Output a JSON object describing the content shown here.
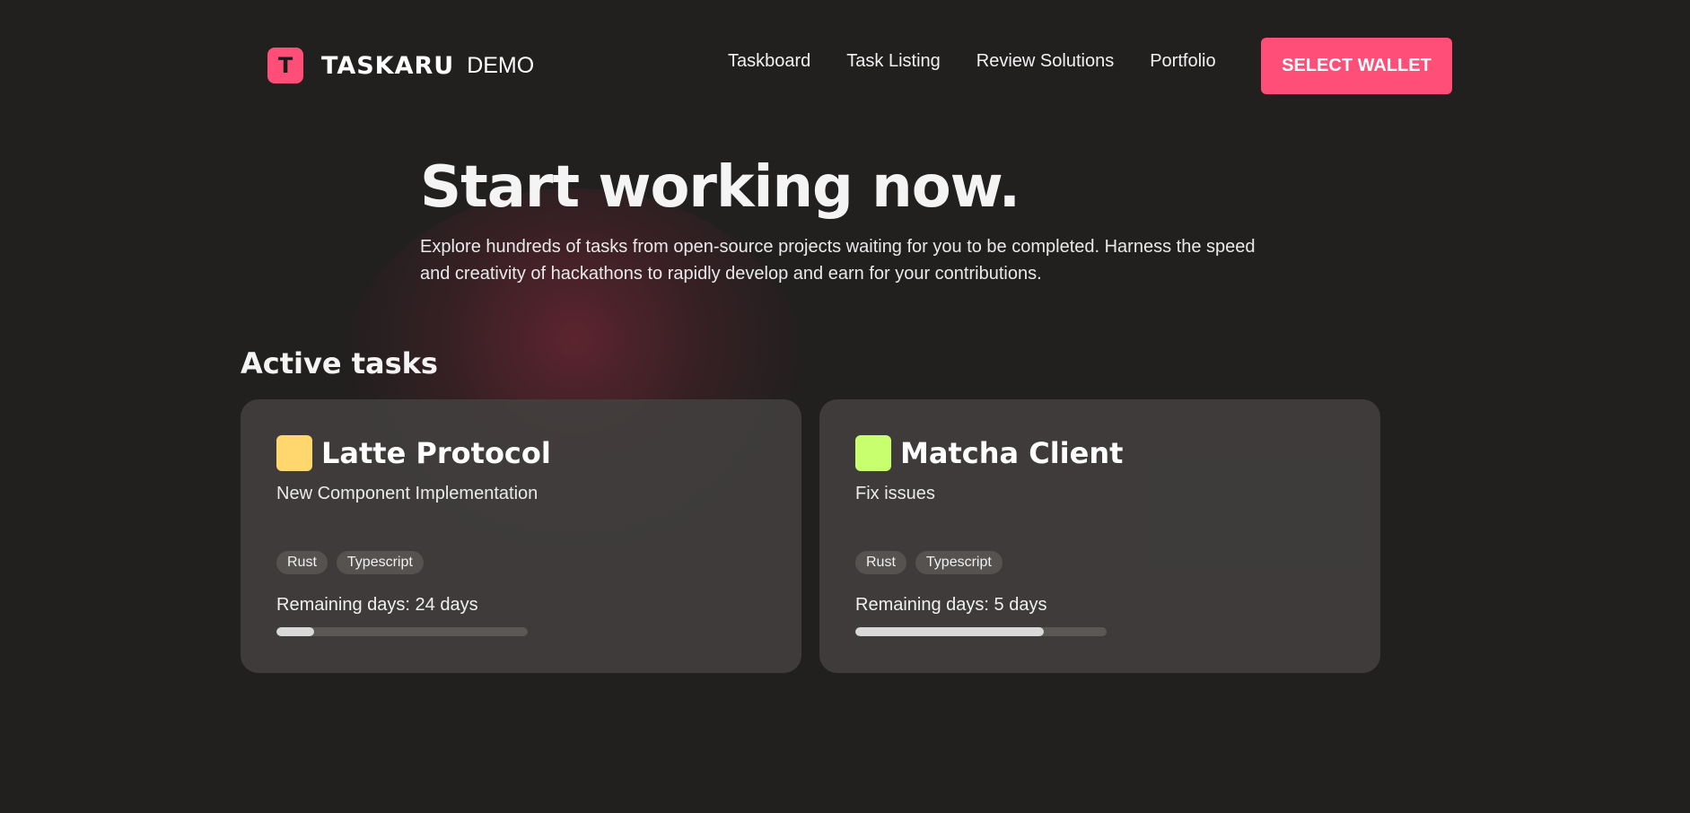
{
  "header": {
    "logo_letter": "T",
    "brand_name": "TASKARU",
    "brand_suffix": "DEMO",
    "nav": [
      {
        "label": "Taskboard"
      },
      {
        "label": "Task Listing"
      },
      {
        "label": "Review Solutions"
      },
      {
        "label": "Portfolio"
      }
    ],
    "wallet_button": "SELECT WALLET"
  },
  "hero": {
    "title": "Start working now.",
    "description": "Explore hundreds of tasks from open-source projects waiting for you to be completed. Harness the speed and creativity of hackathons to rapidly develop and earn for your contributions."
  },
  "active_tasks": {
    "title": "Active tasks",
    "remaining_label": "Remaining days:",
    "cards": [
      {
        "title": "Latte Protocol",
        "subtitle": "New Component Implementation",
        "color": "#ffd76e",
        "tags": [
          "Rust",
          "Typescript"
        ],
        "remaining": "24 days",
        "progress": 0.15
      },
      {
        "title": "Matcha Client",
        "subtitle": "Fix issues",
        "color": "#c7ff6e",
        "tags": [
          "Rust",
          "Typescript"
        ],
        "remaining": "5 days",
        "progress": 0.75
      }
    ]
  },
  "colors": {
    "background": "#221f1f",
    "accent": "#ff4f79",
    "card": "#42403f"
  }
}
